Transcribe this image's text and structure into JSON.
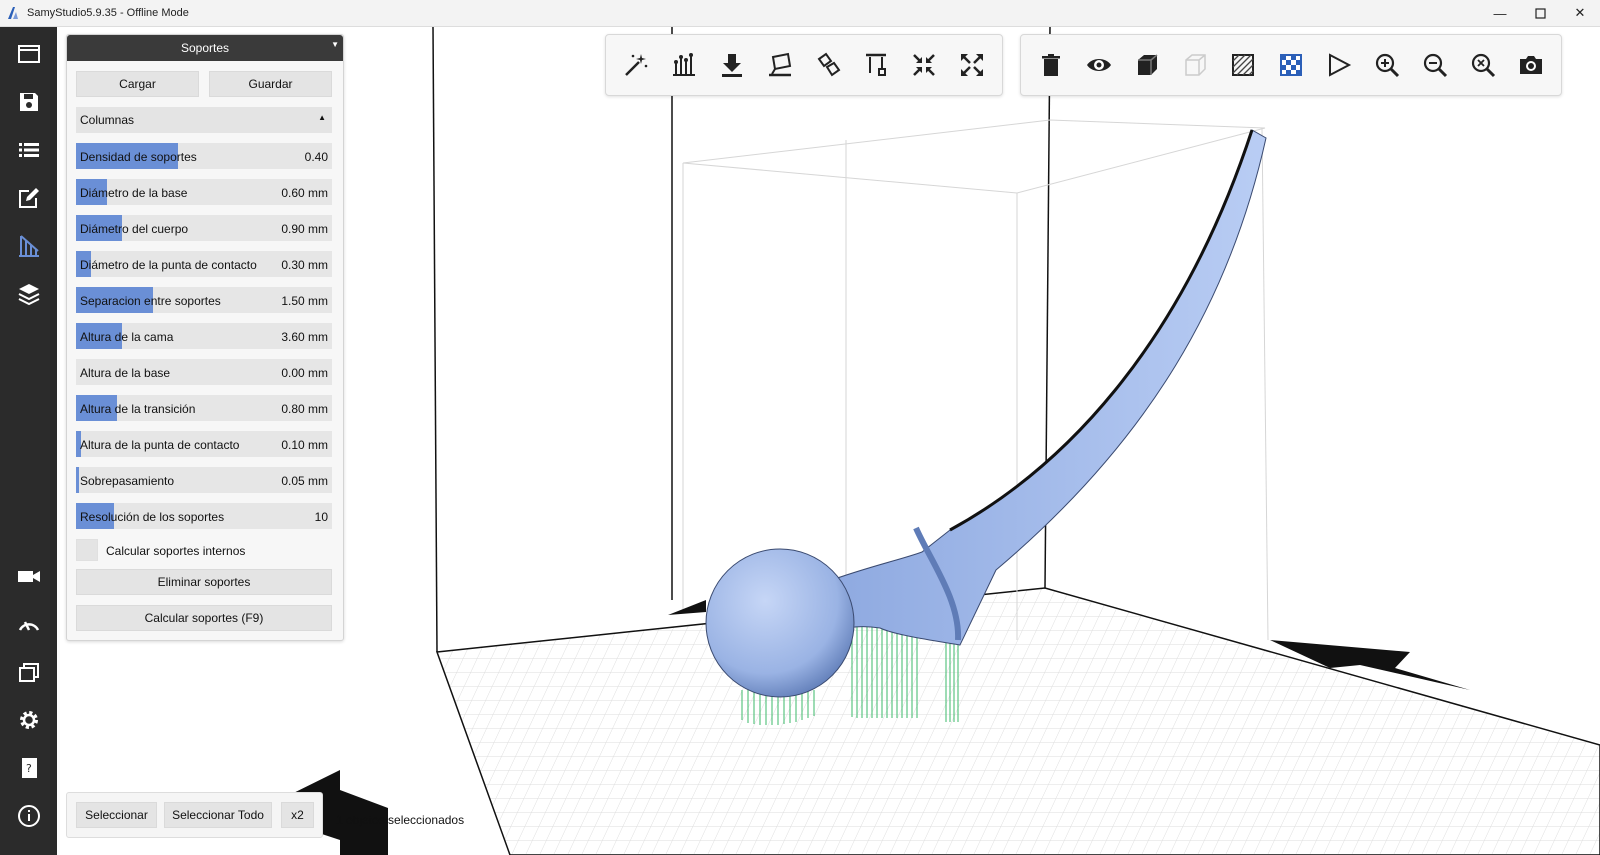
{
  "window": {
    "title": "SamyStudio5.9.35 - Offline Mode"
  },
  "colors": {
    "accent": "#6a8fd6",
    "sidebar": "#2b2b2b",
    "panel_header": "#3a3a3a",
    "model": "#a9c0ee",
    "supports": "#6fd38f"
  },
  "sidebar": {
    "items": [
      "window-icon",
      "save-icon",
      "list-icon",
      "edit-icon",
      "supports-icon",
      "layers-icon",
      "camera-icon",
      "speed-icon",
      "windows-icon",
      "settings-icon",
      "help-book-icon",
      "info-icon"
    ]
  },
  "panel": {
    "title": "Soportes",
    "load_label": "Cargar",
    "save_label": "Guardar",
    "section_label": "Columnas",
    "params": [
      {
        "label": "Densidad de soportes",
        "value": "0.40",
        "fill": 0.4
      },
      {
        "label": "Diámetro de la base",
        "value": "0.60 mm",
        "fill": 0.12
      },
      {
        "label": "Diámetro del cuerpo",
        "value": "0.90 mm",
        "fill": 0.18
      },
      {
        "label": "Diámetro de la punta de contacto",
        "value": "0.30 mm",
        "fill": 0.06
      },
      {
        "label": "Separacion entre soportes",
        "value": "1.50 mm",
        "fill": 0.3
      },
      {
        "label": "Altura de la cama",
        "value": "3.60 mm",
        "fill": 0.18
      },
      {
        "label": "Altura de la base",
        "value": "0.00 mm",
        "fill": 0.0
      },
      {
        "label": "Altura de la transición",
        "value": "0.80 mm",
        "fill": 0.16
      },
      {
        "label": "Altura de la punta de contacto",
        "value": "0.10 mm",
        "fill": 0.02
      },
      {
        "label": "Sobrepasamiento",
        "value": "0.05 mm",
        "fill": 0.01
      },
      {
        "label": "Resolución de los soportes",
        "value": "10",
        "fill": 0.15
      }
    ],
    "internal_label": "Calcular soportes internos",
    "remove_label": "Eliminar soportes",
    "compute_label": "Calcular soportes (F9)"
  },
  "toolbar_left": [
    "auto-support-wand-icon",
    "supports-bars-icon",
    "drop-to-bed-icon",
    "lay-flat-icon",
    "rotate-face-icon",
    "column-support-icon",
    "shrink-icon",
    "expand-icon"
  ],
  "toolbar_right": [
    "delete-icon",
    "eye-icon",
    "solid-cube-icon",
    "wire-cube-icon",
    "hatched-view-icon",
    "checker-view-icon",
    "flag-icon",
    "zoom-in-icon",
    "zoom-out-icon",
    "zoom-fit-icon",
    "screenshot-camera-icon"
  ],
  "bottom": {
    "select_label": "Seleccionar",
    "select_all_label": "Seleccionar Todo",
    "multiplier_label": "x2",
    "status": "1 objetos seleccionados"
  }
}
